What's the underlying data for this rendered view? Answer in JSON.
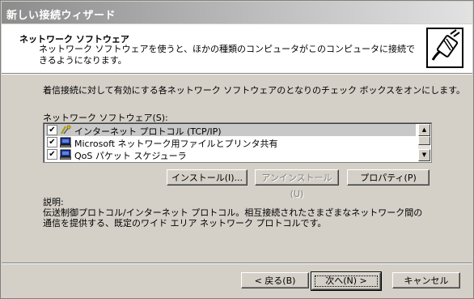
{
  "window": {
    "title": "新しい接続ウィザード"
  },
  "header": {
    "title": "ネットワーク ソフトウェア",
    "subtitle": "ネットワーク ソフトウェアを使うと、ほかの種類のコンピュータがこのコンピュータに接続できるようになります。",
    "icon": "network-cable-plug-icon"
  },
  "instruction": "着信接続に対して有効にする各ネットワーク ソフトウェアのとなりのチェック ボックスをオンにします。",
  "software_list": {
    "label": "ネットワーク ソフトウェア(S):",
    "items": [
      {
        "label": "インターネット プロトコル (TCP/IP)",
        "checked": true,
        "selected": true,
        "icon": "protocol-icon"
      },
      {
        "label": "Microsoft ネットワーク用ファイルとプリンタ共有",
        "checked": true,
        "selected": false,
        "icon": "computer-icon"
      },
      {
        "label": "QoS パケット スケジューラ",
        "checked": true,
        "selected": false,
        "icon": "computer-icon"
      }
    ]
  },
  "list_buttons": {
    "install": "インストール(I)...",
    "uninstall": "アンインストール(U)",
    "properties": "プロパティ(P)"
  },
  "description": {
    "label": "説明:",
    "text": "伝送制御プロトコル/インターネット プロトコル。相互接続されたさまざまなネットワーク間の通信を提供する、既定のワイド エリア ネットワーク プロトコルです。"
  },
  "nav_buttons": {
    "back": "< 戻る(B)",
    "next": "次へ(N) >",
    "cancel": "キャンセル"
  },
  "checkmark": "✔",
  "scroll_up": "▲",
  "scroll_down": "▼"
}
